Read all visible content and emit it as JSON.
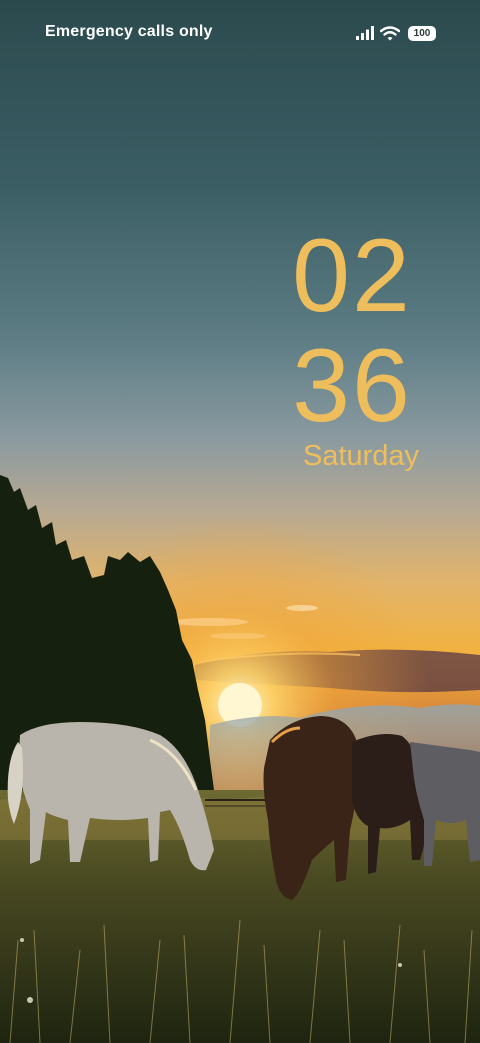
{
  "status_bar": {
    "carrier_text": "Emergency calls only",
    "signal_icon": "cellular-signal-icon",
    "wifi_icon": "wifi-icon",
    "battery_level": "100"
  },
  "clock": {
    "hours": "02",
    "minutes": "36",
    "day": "Saturday"
  },
  "wallpaper": {
    "subject": "horses grazing in a meadow at sunset",
    "colors": {
      "sky_top": "#2b4a4e",
      "sky_mid": "#6a8790",
      "horizon": "#f3b23c",
      "sun": "#fff2b0",
      "clock_accent": "#efbe5c"
    }
  }
}
